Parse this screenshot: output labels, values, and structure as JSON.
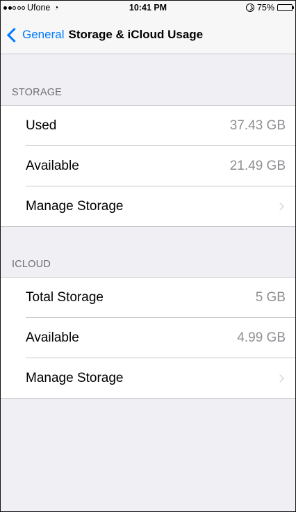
{
  "status_bar": {
    "carrier": "Ufone",
    "time": "10:41 PM",
    "battery": "75%",
    "battery_level": 0.75,
    "signal_bars_filled": 2,
    "signal_bars_total": 5
  },
  "nav": {
    "back_label": "General",
    "title": "Storage & iCloud Usage"
  },
  "sections": {
    "storage": {
      "header": "STORAGE",
      "rows": [
        {
          "label": "Used",
          "value": "37.43 GB"
        },
        {
          "label": "Available",
          "value": "21.49 GB"
        },
        {
          "label": "Manage Storage"
        }
      ]
    },
    "icloud": {
      "header": "ICLOUD",
      "rows": [
        {
          "label": "Total Storage",
          "value": "5 GB"
        },
        {
          "label": "Available",
          "value": "4.99 GB"
        },
        {
          "label": "Manage Storage"
        }
      ]
    }
  },
  "colors": {
    "accent": "#007aff",
    "background": "#efeff4",
    "secondary_text": "#8e8e93"
  },
  "icons": {
    "back": "chevron-left-icon",
    "disclosure": "chevron-right-icon",
    "wifi": "wifi-icon",
    "rotation_lock": "rotation-lock-icon",
    "battery": "battery-icon"
  }
}
